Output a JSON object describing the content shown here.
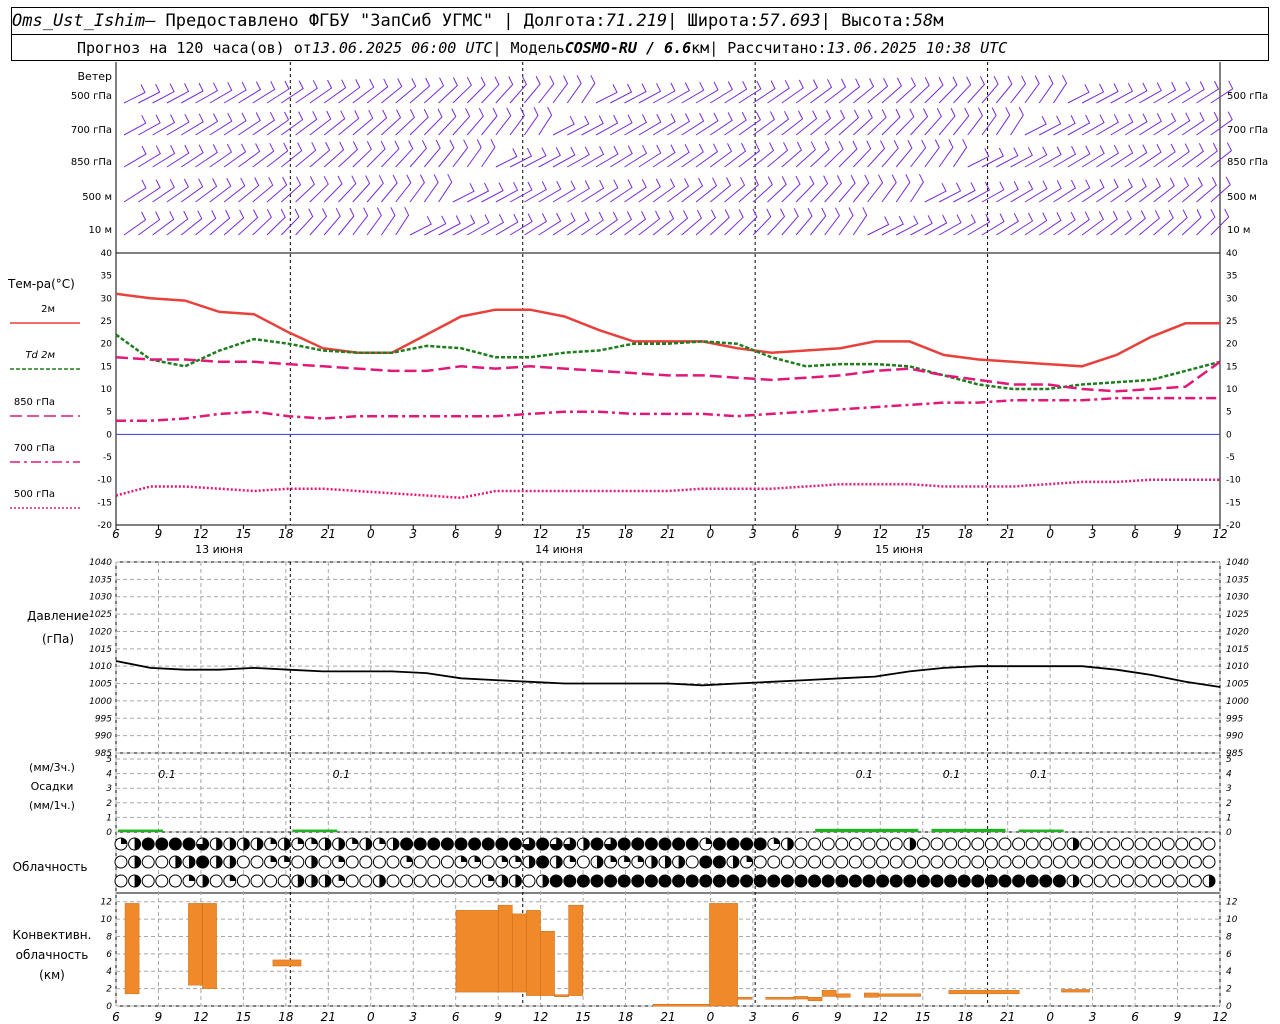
{
  "header": {
    "station": "Oms_Ust_Ishim",
    "provider": " – Предоставлено ФГБУ \"ЗапСиб УГМС\" | Долгота: ",
    "longitude": "71.219",
    "lat_label": " | Широта: ",
    "latitude": "57.693",
    "alt_label": " | Высота: ",
    "altitude": "58",
    "alt_unit": "м",
    "forecast_label": "Прогноз на 120 часа(ов) от ",
    "init_time": "13.06.2025 06:00 UTC",
    "model_label": "  | Модель ",
    "model": "COSMO-RU / 6.6",
    "model_unit": "км",
    "calc_label": " | Рассчитано: ",
    "calc_time": "13.06.2025 10:38 UTC"
  },
  "chart_data": [
    {
      "type": "barbs",
      "title": "Ветер",
      "levels": [
        "500 гПа",
        "700 гПа",
        "850 гПа",
        "500 м",
        "10 м"
      ],
      "color": "#7b2bd6"
    },
    {
      "type": "line",
      "title": "Тем-ра(°С)",
      "ylim": [
        -20,
        40
      ],
      "yticks": [
        -20,
        -15,
        -10,
        -5,
        0,
        5,
        10,
        15,
        20,
        25,
        30,
        35,
        40
      ],
      "xticks": [
        "6",
        "9",
        "12",
        "15",
        "18",
        "21",
        "0",
        "3",
        "6",
        "9",
        "12",
        "15",
        "18",
        "21",
        "0",
        "3",
        "6",
        "9",
        "12",
        "15",
        "18",
        "21",
        "0",
        "3",
        "6",
        "9",
        "12"
      ],
      "dates": [
        "13 июня",
        "14 июня",
        "15 июня"
      ],
      "x_hours": [
        0,
        3,
        6,
        9,
        12,
        15,
        18,
        21,
        24,
        27,
        30,
        33,
        36,
        39,
        42,
        45,
        48,
        51,
        54,
        57,
        60,
        63,
        66,
        69,
        72,
        75,
        78
      ],
      "series": [
        {
          "name": "2м",
          "color": "#e8413c",
          "style": "solid",
          "values": [
            31,
            30,
            29.5,
            27,
            26.5,
            22.5,
            19,
            18,
            18,
            22,
            26,
            27.5,
            27.5,
            26,
            23,
            20.5,
            20.5,
            20.5,
            19,
            18,
            18.5,
            19,
            20.5,
            20.5,
            17.5,
            16.5,
            16,
            15.5,
            15,
            17.5,
            21.5,
            24.5,
            24.5
          ]
        },
        {
          "name": "Td  2м",
          "color": "#1e7d1e",
          "style": "dashed",
          "values": [
            22,
            16.5,
            15,
            18.5,
            21,
            20,
            18.5,
            18,
            18,
            19.5,
            19,
            17,
            17,
            18,
            18.5,
            20,
            20,
            20.5,
            20,
            17,
            15,
            15.5,
            15.5,
            15,
            13,
            11,
            10,
            10,
            11,
            11.5,
            12,
            14,
            16
          ]
        },
        {
          "name": "850 гПа",
          "color": "#e0187a",
          "style": "longdash",
          "values": [
            17,
            16.5,
            16.5,
            16,
            16,
            15.5,
            15,
            14.5,
            14,
            14,
            15,
            14.5,
            15,
            14.5,
            14,
            13.5,
            13,
            13,
            12.5,
            12,
            12.5,
            13,
            14,
            14.5,
            13,
            12,
            11,
            11,
            10,
            9.5,
            10,
            10.5,
            16
          ]
        },
        {
          "name": "700 гПа",
          "color": "#e0187a",
          "style": "dashdot",
          "values": [
            3,
            3,
            3.5,
            4.5,
            5,
            4,
            3.5,
            4,
            4,
            4,
            4,
            4,
            4.5,
            5,
            5,
            4.5,
            4.5,
            4.5,
            4,
            4.5,
            5,
            5.5,
            6,
            6.5,
            7,
            7,
            7.5,
            7.5,
            7.5,
            8,
            8,
            8,
            8
          ]
        },
        {
          "name": "500 гПа",
          "color": "#e0187a",
          "style": "dotted",
          "values": [
            -13.5,
            -11.5,
            -11.5,
            -12,
            -12.5,
            -12,
            -12,
            -12.5,
            -13,
            -13.5,
            -14,
            -12.5,
            -12.5,
            -12.5,
            -12.5,
            -12.5,
            -12.5,
            -12,
            -12,
            -12,
            -11.5,
            -11,
            -11,
            -11,
            -11.5,
            -11.5,
            -11.5,
            -11,
            -10.5,
            -10.5,
            -10,
            -10,
            -10
          ]
        }
      ]
    },
    {
      "type": "line",
      "title": "Давление",
      "ylabel": "(гПа)",
      "ylim": [
        985,
        1040
      ],
      "yticks": [
        985,
        990,
        995,
        1000,
        1005,
        1010,
        1015,
        1020,
        1025,
        1030,
        1035,
        1040
      ],
      "series": [
        {
          "name": "",
          "color": "#000000",
          "values": [
            1011.5,
            1009.5,
            1009,
            1009,
            1009.5,
            1009,
            1008.5,
            1008.5,
            1008.5,
            1008,
            1006.5,
            1006,
            1005.5,
            1005,
            1005,
            1005,
            1005,
            1004.5,
            1005,
            1005.5,
            1006,
            1006.5,
            1007,
            1008.5,
            1009.5,
            1010,
            1010,
            1010,
            1010,
            1009,
            1007.5,
            1005.5,
            1004
          ]
        }
      ]
    },
    {
      "type": "bar",
      "title": "Осадки",
      "ylabel": "(мм/3ч.)",
      "ylabel2": "(мм/1ч.)",
      "ylim": [
        0,
        5
      ],
      "yticks": [
        0,
        1,
        2,
        3,
        4,
        5
      ],
      "annotations": [
        {
          "hour": 1,
          "text": "0.1"
        },
        {
          "hour": 7,
          "text": "0.1"
        },
        {
          "hour": 25,
          "text": "0.1"
        },
        {
          "hour": 28,
          "text": "0.1"
        },
        {
          "hour": 31,
          "text": "0.1"
        }
      ],
      "bars": [
        {
          "start": 0,
          "end": 1,
          "value": 0.1
        },
        {
          "start": 6,
          "end": 7,
          "value": 0.1
        },
        {
          "start": 24,
          "end": 27,
          "value": 0.15
        },
        {
          "start": 28,
          "end": 30,
          "value": 0.15
        },
        {
          "start": 31,
          "end": 32,
          "value": 0.1
        }
      ]
    },
    {
      "type": "table",
      "title": "Облачность",
      "rows": [
        [
          1,
          2,
          4,
          4,
          4,
          4,
          3,
          2,
          2,
          2,
          2,
          1,
          2,
          1,
          1,
          2,
          2,
          1,
          2,
          1,
          2,
          4,
          4,
          4,
          4,
          4,
          4,
          4,
          4,
          4,
          3,
          4,
          3,
          3,
          2,
          4,
          3,
          4,
          4,
          4,
          4,
          4,
          4,
          1,
          4,
          4,
          4,
          4,
          1,
          2,
          0,
          0,
          0,
          0,
          0,
          0,
          0,
          0,
          2,
          0,
          0,
          0,
          0,
          0,
          0,
          0,
          0,
          0,
          0,
          0,
          2,
          0,
          0,
          0,
          0,
          0,
          0,
          0,
          0,
          0,
          0
        ],
        [
          0,
          2,
          0,
          0,
          2,
          2,
          4,
          2,
          2,
          0,
          0,
          1,
          1,
          0,
          2,
          0,
          1,
          0,
          0,
          0,
          0,
          1,
          0,
          0,
          0,
          1,
          1,
          0,
          1,
          1,
          2,
          4,
          2,
          1,
          0,
          2,
          1,
          1,
          1,
          2,
          2,
          2,
          0,
          4,
          4,
          2,
          1,
          0,
          0,
          0,
          0,
          0,
          0,
          0,
          0,
          0,
          0,
          0,
          0,
          0,
          0,
          0,
          0,
          0,
          0,
          0,
          0,
          0,
          0,
          0,
          0,
          0,
          0,
          0,
          0,
          0,
          0,
          0,
          0,
          0,
          0
        ],
        [
          0,
          2,
          0,
          0,
          0,
          1,
          2,
          0,
          1,
          0,
          0,
          0,
          0,
          2,
          2,
          2,
          1,
          0,
          0,
          2,
          0,
          0,
          0,
          0,
          0,
          0,
          0,
          1,
          2,
          2,
          0,
          2,
          4,
          4,
          4,
          4,
          4,
          4,
          4,
          4,
          4,
          4,
          4,
          4,
          4,
          4,
          4,
          4,
          4,
          4,
          4,
          4,
          4,
          4,
          4,
          4,
          4,
          4,
          4,
          4,
          4,
          4,
          4,
          4,
          4,
          4,
          4,
          4,
          4,
          4,
          2,
          0,
          0,
          0,
          0,
          0,
          0,
          0,
          0,
          0,
          2
        ]
      ]
    },
    {
      "type": "bar",
      "title": "Конвективн. облачность",
      "ylabel": "(км)",
      "ylim": [
        0,
        13
      ],
      "yticks": [
        0,
        2,
        4,
        6,
        8,
        10,
        12
      ],
      "bars": [
        {
          "start": 0.5,
          "end": 1.5,
          "bottom": 1.4,
          "top": 11.8
        },
        {
          "start": 5,
          "end": 6,
          "bottom": 2.4,
          "top": 11.8
        },
        {
          "start": 6,
          "end": 7,
          "bottom": 2.0,
          "top": 11.8
        },
        {
          "start": 11,
          "end": 13,
          "bottom": 4.6,
          "top": 5.3
        },
        {
          "start": 24,
          "end": 27,
          "bottom": 1.6,
          "top": 11.0
        },
        {
          "start": 27,
          "end": 28,
          "bottom": 1.6,
          "top": 11.6
        },
        {
          "start": 28,
          "end": 29,
          "bottom": 1.6,
          "top": 10.6
        },
        {
          "start": 29,
          "end": 30,
          "bottom": 1.2,
          "top": 11.0
        },
        {
          "start": 30,
          "end": 31,
          "bottom": 1.2,
          "top": 8.6
        },
        {
          "start": 31,
          "end": 32,
          "bottom": 1.2,
          "top": 1.3
        },
        {
          "start": 32,
          "end": 33,
          "bottom": 1.2,
          "top": 11.6
        },
        {
          "start": 38,
          "end": 42,
          "bottom": 0.0,
          "top": 0.2
        },
        {
          "start": 42,
          "end": 44,
          "bottom": 0.0,
          "top": 11.8
        },
        {
          "start": 44,
          "end": 45,
          "bottom": 0.8,
          "top": 1.0
        },
        {
          "start": 46,
          "end": 48,
          "bottom": 0.8,
          "top": 1.0
        },
        {
          "start": 48,
          "end": 49,
          "bottom": 0.8,
          "top": 1.1
        },
        {
          "start": 49,
          "end": 50,
          "bottom": 0.6,
          "top": 1.0
        },
        {
          "start": 50,
          "end": 51,
          "bottom": 1.1,
          "top": 1.8
        },
        {
          "start": 51,
          "end": 52,
          "bottom": 1.0,
          "top": 1.4
        },
        {
          "start": 53,
          "end": 54,
          "bottom": 1.0,
          "top": 1.5
        },
        {
          "start": 54,
          "end": 57,
          "bottom": 1.1,
          "top": 1.4
        },
        {
          "start": 59,
          "end": 64,
          "bottom": 1.4,
          "top": 1.8
        },
        {
          "start": 67,
          "end": 69,
          "bottom": 1.6,
          "top": 1.9
        }
      ]
    }
  ],
  "colors": {
    "wind": "#7b2bd6",
    "grid": "#a8a8a8",
    "zero_line": "#3a3adb",
    "precip": "#22b022",
    "convective": "#f0892a"
  }
}
